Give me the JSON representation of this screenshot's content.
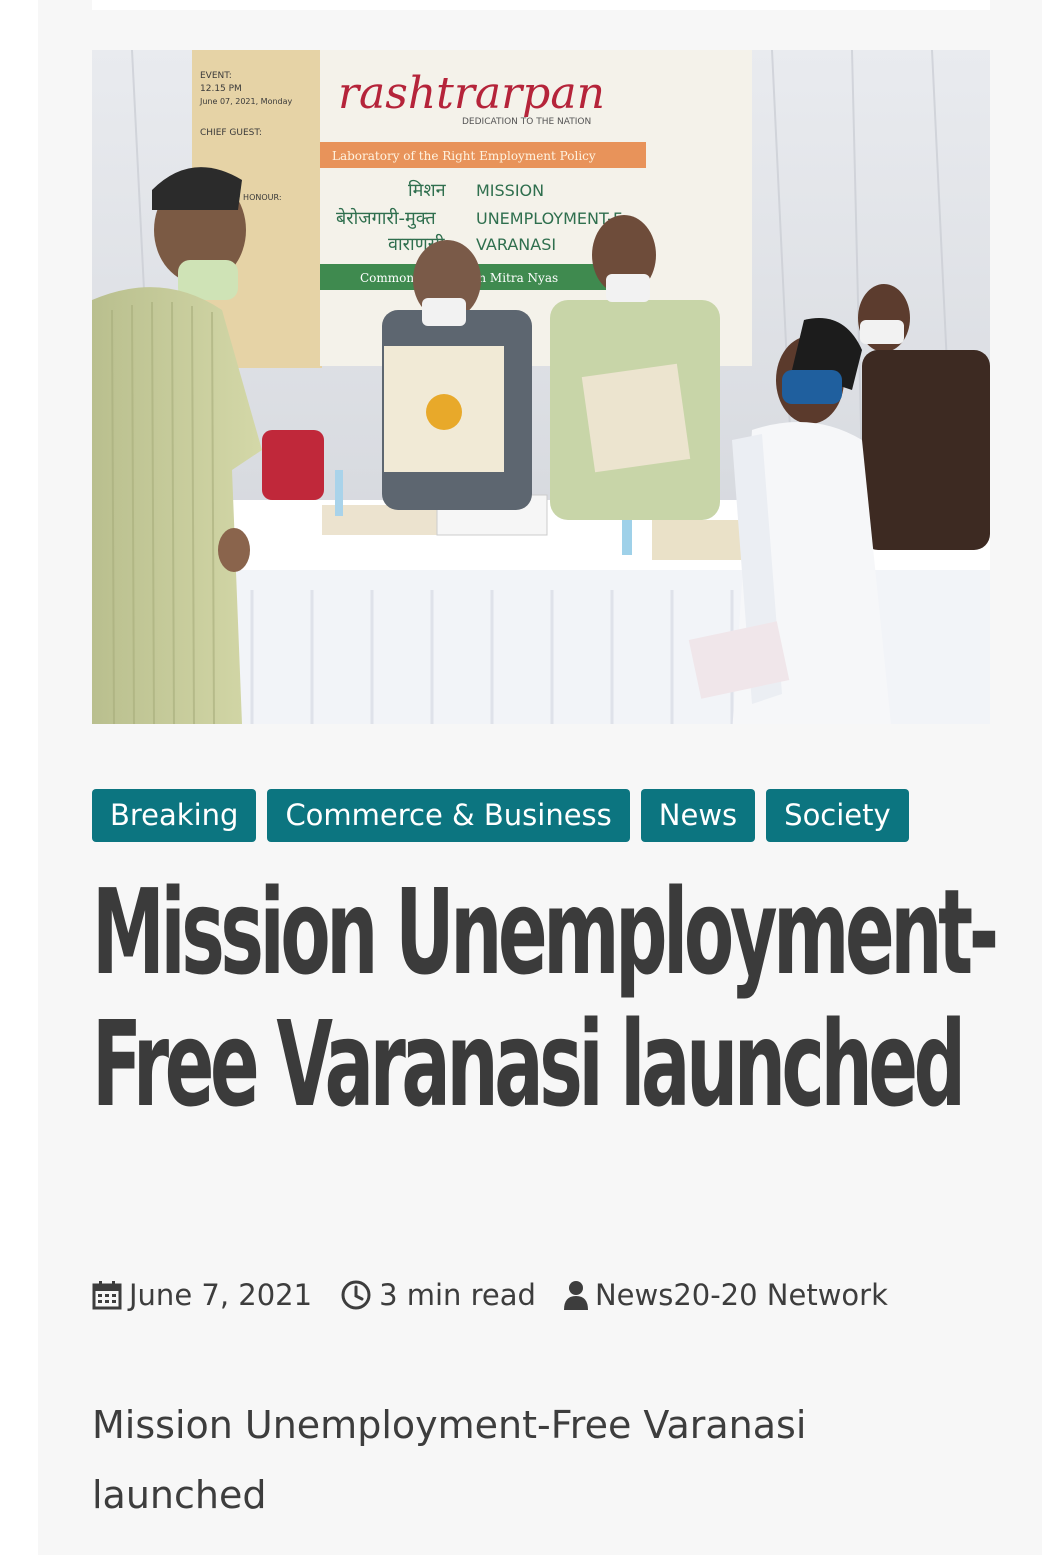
{
  "hero": {
    "banner_brand": "rashtrarpan",
    "banner_tagline": "DEDICATION TO THE NATION",
    "banner_subtitle": "Laboratory of the Right Employment Policy",
    "banner_mission_hi": "मिशन",
    "banner_mission_en": "MISSION",
    "banner_line2_hi": "बेरोजगारी-मुक्त",
    "banner_line2_en": "UNEMPLOYMENT-F",
    "banner_line3_hi": "वाराणसी",
    "banner_line3_en": "VARANASI",
    "banner_green": "Common... ust & Jan Mitra Nyas",
    "poster_event": "EVENT:",
    "poster_time": "12.15 PM",
    "poster_date": "June 07, 2021, Monday",
    "poster_chief": "CHIEF GUEST:",
    "poster_honour": "GUEST OF HONOUR:"
  },
  "categories": [
    "Breaking",
    "Commerce & Business",
    "News",
    "Society"
  ],
  "article": {
    "title": "Mission Unemployment-Free Varanasi launched",
    "date": "June 7, 2021",
    "read_time": "3 min read",
    "author": "News20-20 Network",
    "excerpt": "Mission Unemployment-Free Varanasi launched"
  },
  "colors": {
    "category_bg": "#0c7580",
    "title_text": "#3b3b3b",
    "page_bg": "#f7f7f7"
  },
  "icons": [
    "calendar-icon",
    "clock-icon",
    "user-icon"
  ]
}
